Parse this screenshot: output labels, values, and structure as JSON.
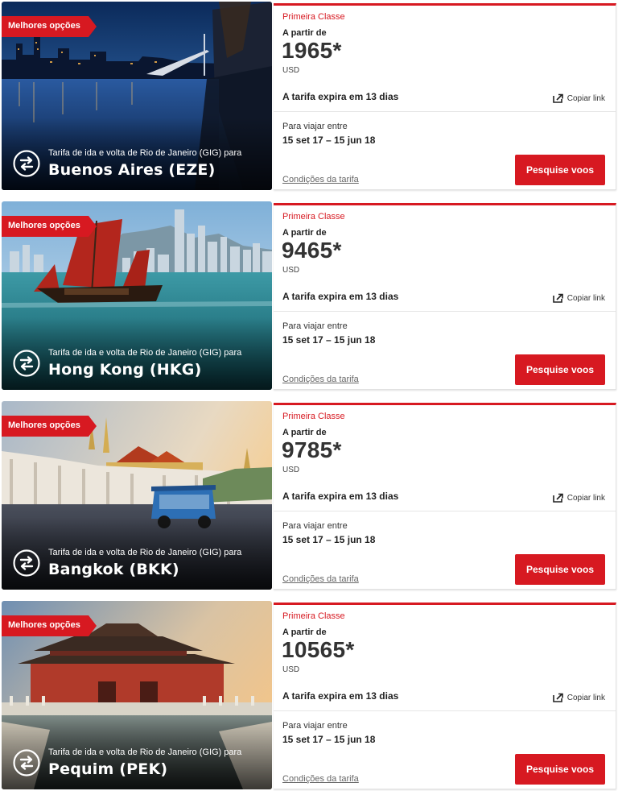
{
  "colors": {
    "accent": "#d71921",
    "badge": "#d71921"
  },
  "cards": [
    {
      "badge": "Melhores opções",
      "route_text": "Tarifa de ida e volta de Rio de Janeiro (GIG) para",
      "destination": "Buenos Aires (EZE)",
      "cabin": "Primeira Classe",
      "from_label": "A partir de",
      "price": "1965*",
      "currency": "USD",
      "expires": "A tarifa expira em 13 dias",
      "copy_link": "Copiar link",
      "travel_label": "Para viajar entre",
      "dates": "15 set 17 – 15 jun 18",
      "conditions": "Condições da tarifa",
      "search_button": "Pesquise voos"
    },
    {
      "badge": "Melhores opções",
      "route_text": "Tarifa de ida e volta de Rio de Janeiro (GIG) para",
      "destination": "Hong Kong (HKG)",
      "cabin": "Primeira Classe",
      "from_label": "A partir de",
      "price": "9465*",
      "currency": "USD",
      "expires": "A tarifa expira em 13 dias",
      "copy_link": "Copiar link",
      "travel_label": "Para viajar entre",
      "dates": "15 set 17 – 15 jun 18",
      "conditions": "Condições da tarifa",
      "search_button": "Pesquise voos"
    },
    {
      "badge": "Melhores opções",
      "route_text": "Tarifa de ida e volta de Rio de Janeiro (GIG) para",
      "destination": "Bangkok (BKK)",
      "cabin": "Primeira Classe",
      "from_label": "A partir de",
      "price": "9785*",
      "currency": "USD",
      "expires": "A tarifa expira em 13 dias",
      "copy_link": "Copiar link",
      "travel_label": "Para viajar entre",
      "dates": "15 set 17 – 15 jun 18",
      "conditions": "Condições da tarifa",
      "search_button": "Pesquise voos"
    },
    {
      "badge": "Melhores opções",
      "route_text": "Tarifa de ida e volta de Rio de Janeiro (GIG) para",
      "destination": "Pequim (PEK)",
      "cabin": "Primeira Classe",
      "from_label": "A partir de",
      "price": "10565*",
      "currency": "USD",
      "expires": "A tarifa expira em 13 dias",
      "copy_link": "Copiar link",
      "travel_label": "Para viajar entre",
      "dates": "15 set 17 – 15 jun 18",
      "conditions": "Condições da tarifa",
      "search_button": "Pesquise voos"
    }
  ]
}
